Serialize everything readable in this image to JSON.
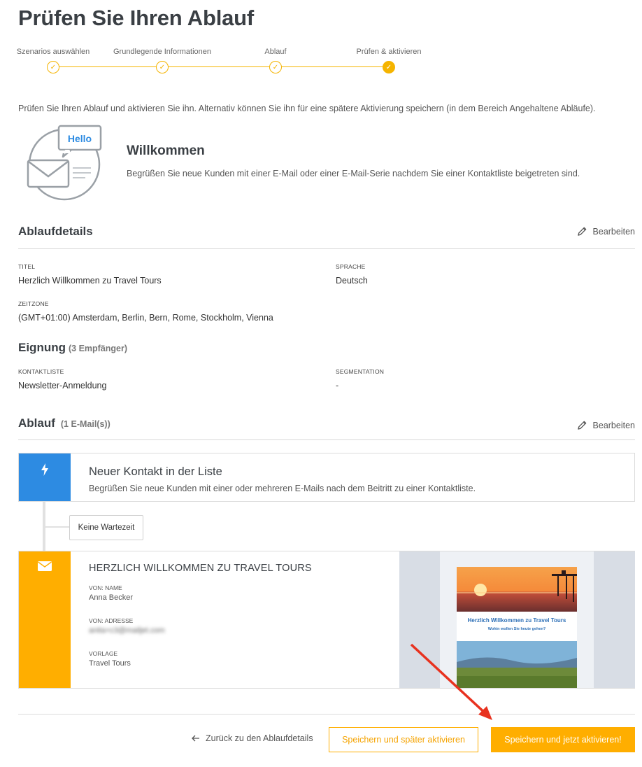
{
  "page": {
    "title": "Prüfen Sie Ihren Ablauf"
  },
  "stepper": {
    "steps": [
      {
        "label": "Szenarios auswählen",
        "state": "done"
      },
      {
        "label": "Grundlegende Informationen",
        "state": "done"
      },
      {
        "label": "Ablauf",
        "state": "done"
      },
      {
        "label": "Prüfen & aktivieren",
        "state": "active"
      }
    ],
    "accent_color": "#f5b400"
  },
  "intro": "Prüfen Sie Ihren Ablauf und aktivieren Sie ihn. Alternativ können Sie ihn für eine spätere Aktivierung speichern (in dem Bereich Angehaltene Abläufe).",
  "welcome": {
    "bubble_text": "Hello",
    "title": "Willkommen",
    "description": "Begrüßen Sie neue Kunden mit einer E-Mail oder einer E-Mail-Serie nachdem Sie einer Kontaktliste beigetreten sind."
  },
  "details": {
    "heading": "Ablaufdetails",
    "edit_label": "Bearbeiten",
    "fields": {
      "title_label": "TITEL",
      "title_value": "Herzlich Willkommen zu Travel Tours",
      "language_label": "SPRACHE",
      "language_value": "Deutsch",
      "timezone_label": "ZEITZONE",
      "timezone_value": "(GMT+01:00) Amsterdam, Berlin, Bern, Rome, Stockholm, Vienna"
    }
  },
  "eligibility": {
    "heading": "Eignung",
    "recipients": "(3 Empfänger)",
    "contactlist_label": "KONTAKTLISTE",
    "contactlist_value": "Newsletter-Anmeldung",
    "segmentation_label": "SEGMENTATION",
    "segmentation_value": "-"
  },
  "flow": {
    "heading": "Ablauf",
    "count": "(1 E-Mail(s))",
    "edit_label": "Bearbeiten",
    "trigger": {
      "title": "Neuer Kontakt in der Liste",
      "description": "Begrüßen Sie neue Kunden mit einer oder mehreren E-Mails nach dem Beitritt zu einer Kontaktliste.",
      "color": "#2d8be2"
    },
    "wait": "Keine Wartezeit",
    "email": {
      "title": "HERZLICH WILLKOMMEN ZU TRAVEL TOURS",
      "from_name_label": "VON: NAME",
      "from_name_value": "Anna Becker",
      "from_address_label": "VON: ADRESSE",
      "from_address_value": "anita+c3@mailjet.com",
      "template_label": "VORLAGE",
      "template_value": "Travel Tours",
      "color": "#ffae00",
      "preview": {
        "headline": "Herzlich Willkommen zu Travel Tours",
        "subline": "Wohin wollen Sie heute gehen?"
      }
    }
  },
  "footer": {
    "back_label": "Zurück zu den Ablaufdetails",
    "save_later_label": "Speichern und später aktivieren",
    "save_now_label": "Speichern und jetzt aktivieren!"
  }
}
